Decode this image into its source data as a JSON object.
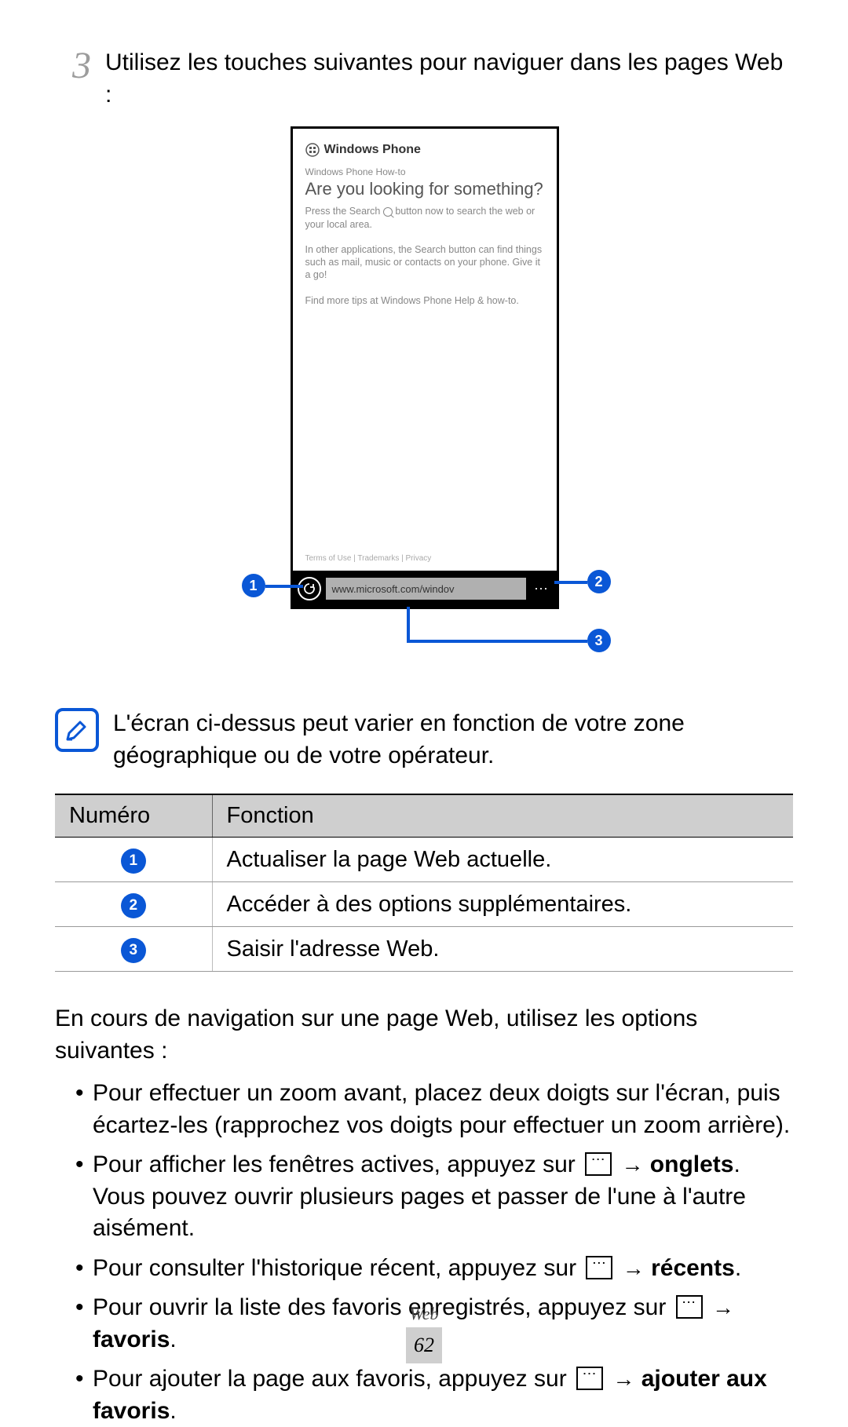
{
  "step": {
    "number": "3",
    "text": "Utilisez les touches suivantes pour naviguer dans les pages Web :"
  },
  "phone": {
    "brand": "Windows Phone",
    "subhead": "Windows Phone How-to",
    "title": "Are you looking for something?",
    "para1_a": "Press the Search ",
    "para1_b": " button now to search the web or your local area.",
    "para2": "In other applications, the Search button can find things such as mail, music or contacts on your phone. Give it a go!",
    "para3": "Find more tips at Windows Phone Help & how-to.",
    "links": "Terms of Use | Trademarks | Privacy",
    "address": "www.microsoft.com/windov"
  },
  "callouts": {
    "c1": "1",
    "c2": "2",
    "c3": "3"
  },
  "note": "L'écran ci-dessus peut varier en fonction de votre zone géographique ou de votre opérateur.",
  "table": {
    "headers": {
      "num": "Numéro",
      "func": "Fonction"
    },
    "rows": [
      {
        "n": "1",
        "f": "Actualiser la page Web actuelle."
      },
      {
        "n": "2",
        "f": "Accéder à des options supplémentaires."
      },
      {
        "n": "3",
        "f": "Saisir l'adresse Web."
      }
    ]
  },
  "body_intro": "En cours de navigation sur une page Web, utilisez les options suivantes :",
  "bullets": {
    "b1": "Pour effectuer un zoom avant, placez deux doigts sur l'écran, puis écartez-les (rapprochez vos doigts pour effectuer un zoom arrière).",
    "b2_a": "Pour afficher les fenêtres actives, appuyez sur ",
    "b2_b": "onglets",
    "b2_c": ". Vous pouvez ouvrir plusieurs pages et passer de l'une à l'autre aisément.",
    "b3_a": "Pour consulter l'historique récent, appuyez sur ",
    "b3_b": "récents",
    "b3_c": ".",
    "b4_a": "Pour ouvrir la liste des favoris enregistrés, appuyez sur ",
    "b4_b": "favoris",
    "b4_c": ".",
    "b5_a": "Pour ajouter la page aux favoris, appuyez sur ",
    "b5_b": "ajouter aux favoris",
    "b5_c": "."
  },
  "arrow": "→",
  "footer": {
    "section": "Web",
    "page": "62"
  }
}
